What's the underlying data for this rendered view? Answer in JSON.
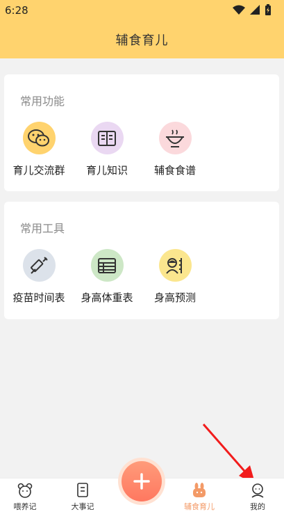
{
  "status": {
    "time": "6:28"
  },
  "header": {
    "title": "辅食育儿"
  },
  "sections": [
    {
      "title": "常用功能",
      "items": [
        {
          "label": "育儿交流群",
          "icon": "wechat-icon",
          "bg": "#ffd36e"
        },
        {
          "label": "育儿知识",
          "icon": "book-icon",
          "bg": "#ead8f2"
        },
        {
          "label": "辅食食谱",
          "icon": "bowl-icon",
          "bg": "#fbd9dc"
        }
      ]
    },
    {
      "title": "常用工具",
      "items": [
        {
          "label": "疫苗时间表",
          "icon": "syringe-icon",
          "bg": "#dce2ea"
        },
        {
          "label": "身高体重表",
          "icon": "table-icon",
          "bg": "#cde7c6"
        },
        {
          "label": "身高预测",
          "icon": "height-predict-icon",
          "bg": "#fbe68e"
        }
      ]
    }
  ],
  "tabbar": {
    "tabs": [
      {
        "label": "喂养记",
        "icon": "bear-icon"
      },
      {
        "label": "大事记",
        "icon": "notebook-icon"
      },
      {
        "label": "辅食育儿",
        "icon": "rabbit-icon",
        "active": true
      },
      {
        "label": "我的",
        "icon": "profile-icon"
      }
    ],
    "fab_icon": "plus-icon"
  },
  "colors": {
    "header": "#ffd36e",
    "accent": "#f39a67",
    "fab": "#ff7860",
    "arrow": "#f21c1c"
  }
}
